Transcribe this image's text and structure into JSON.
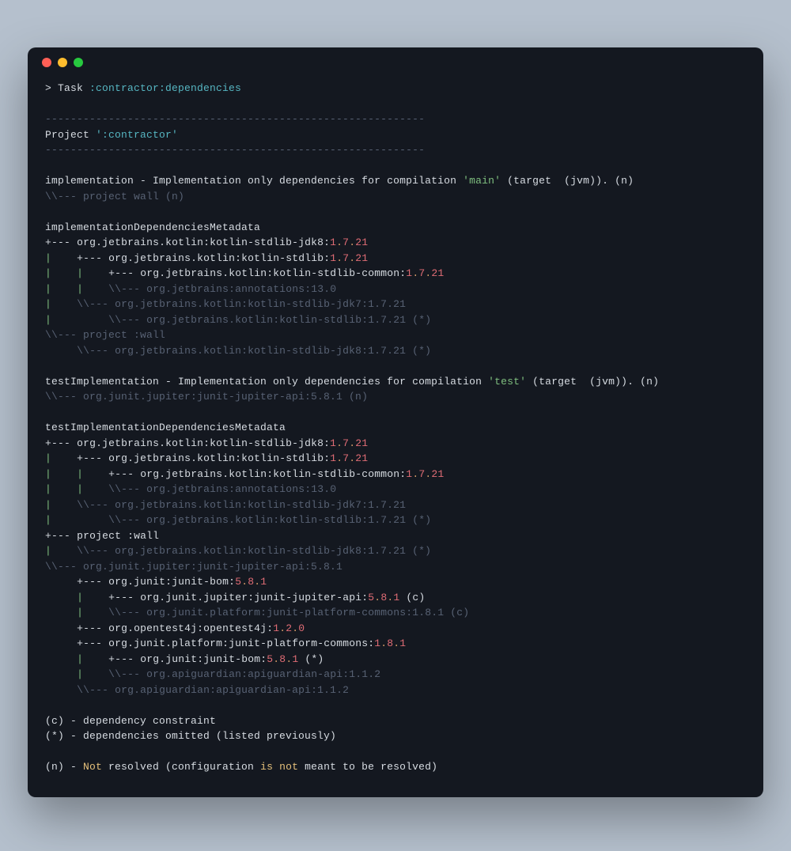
{
  "task_line": {
    "prefix": "> Task ",
    "path": ":contractor:dependencies"
  },
  "dash_line": "------------------------------------------------------------",
  "project_line": {
    "label": "Project ",
    "name": "':contractor'"
  },
  "impl_header": {
    "pre": "implementation - Implementation only dependencies for compilation ",
    "compilation": "'main'",
    "post": " (target  (jvm)). (n)"
  },
  "impl_n_line": "\\\\--- project wall (n)",
  "impl_meta_header": "implementationDependenciesMetadata",
  "tree1": [
    {
      "p": "+--- ",
      "a": "org.jetbrains.kotlin:kotlin-stdlib-jdk8:",
      "v": [
        "1",
        ".",
        "7",
        ".",
        "21"
      ],
      "g": ""
    },
    {
      "p": "|    +--- ",
      "a": "org.jetbrains.kotlin:kotlin-stdlib:",
      "v": [
        "1",
        ".",
        "7",
        ".",
        "21"
      ],
      "g": ""
    },
    {
      "p": "|    |    +--- ",
      "a": "org.jetbrains.kotlin:kotlin-stdlib-common:",
      "v": [
        "1",
        ".",
        "7",
        ".",
        "21"
      ],
      "g": ""
    },
    {
      "p": "|    |    ",
      "a": "",
      "v": [],
      "g": "\\\\--- org.jetbrains:annotations:13.0"
    },
    {
      "p": "|    ",
      "a": "",
      "v": [],
      "g": "\\\\--- org.jetbrains.kotlin:kotlin-stdlib-jdk7:1.7.21"
    },
    {
      "p": "|         ",
      "a": "",
      "v": [],
      "g": "\\\\--- org.jetbrains.kotlin:kotlin-stdlib:1.7.21 (*)"
    },
    {
      "p": "",
      "a": "",
      "v": [],
      "g": "\\\\--- project :wall"
    },
    {
      "p": "     ",
      "a": "",
      "v": [],
      "g": "\\\\--- org.jetbrains.kotlin:kotlin-stdlib-jdk8:1.7.21 (*)"
    }
  ],
  "test_impl_header": {
    "pre": "testImplementation - Implementation only dependencies for compilation ",
    "compilation": "'test'",
    "post": " (target  (jvm)). (n)"
  },
  "test_impl_n_line": "\\\\--- org.junit.jupiter:junit-jupiter-api:5.8.1 (n)",
  "test_meta_header": "testImplementationDependenciesMetadata",
  "tree2": [
    {
      "p": "+--- ",
      "a": "org.jetbrains.kotlin:kotlin-stdlib-jdk8:",
      "v": [
        "1",
        ".",
        "7",
        ".",
        "21"
      ],
      "g": ""
    },
    {
      "p": "|    +--- ",
      "a": "org.jetbrains.kotlin:kotlin-stdlib:",
      "v": [
        "1",
        ".",
        "7",
        ".",
        "21"
      ],
      "g": ""
    },
    {
      "p": "|    |    +--- ",
      "a": "org.jetbrains.kotlin:kotlin-stdlib-common:",
      "v": [
        "1",
        ".",
        "7",
        ".",
        "21"
      ],
      "g": ""
    },
    {
      "p": "|    |    ",
      "a": "",
      "v": [],
      "g": "\\\\--- org.jetbrains:annotations:13.0"
    },
    {
      "p": "|    ",
      "a": "",
      "v": [],
      "g": "\\\\--- org.jetbrains.kotlin:kotlin-stdlib-jdk7:1.7.21"
    },
    {
      "p": "|         ",
      "a": "",
      "v": [],
      "g": "\\\\--- org.jetbrains.kotlin:kotlin-stdlib:1.7.21 (*)"
    },
    {
      "p": "+--- ",
      "a": "project :wall",
      "v": [],
      "g": ""
    },
    {
      "p": "|    ",
      "a": "",
      "v": [],
      "g": "\\\\--- org.jetbrains.kotlin:kotlin-stdlib-jdk8:1.7.21 (*)"
    },
    {
      "p": "",
      "a": "",
      "v": [],
      "g": "\\\\--- org.junit.jupiter:junit-jupiter-api:5.8.1"
    },
    {
      "p": "     +--- ",
      "a": "org.junit:junit-bom:",
      "v": [
        "5",
        ".",
        "8",
        ".",
        "1"
      ],
      "g": ""
    },
    {
      "p": "     |    +--- ",
      "a": "org.junit.jupiter:junit-jupiter-api:",
      "v": [
        "5",
        ".",
        "8",
        ".",
        "1"
      ],
      "g": "",
      "t": " (c)"
    },
    {
      "p": "     |    ",
      "a": "",
      "v": [],
      "g": "\\\\--- org.junit.platform:junit-platform-commons:1.8.1 (c)"
    },
    {
      "p": "     +--- ",
      "a": "org.opentest4j:opentest4j:",
      "v": [
        "1",
        ".",
        "2",
        ".",
        "0"
      ],
      "g": ""
    },
    {
      "p": "     +--- ",
      "a": "org.junit.platform:junit-platform-commons:",
      "v": [
        "1",
        ".",
        "8",
        ".",
        "1"
      ],
      "g": ""
    },
    {
      "p": "     |    +--- ",
      "a": "org.junit:junit-bom:",
      "v": [
        "5",
        ".",
        "8",
        ".",
        "1"
      ],
      "g": "",
      "t": " (*)"
    },
    {
      "p": "     |    ",
      "a": "",
      "v": [],
      "g": "\\\\--- org.apiguardian:apiguardian-api:1.1.2"
    },
    {
      "p": "     ",
      "a": "",
      "v": [],
      "g": "\\\\--- org.apiguardian:apiguardian-api:1.1.2"
    }
  ],
  "legend": {
    "c": "(c) - dependency constraint",
    "star": "(*) - dependencies omitted (listed previously)",
    "n_pre": "(n) - ",
    "n_not": "Not",
    "n_mid": " resolved (configuration ",
    "n_isnot": "is not",
    "n_post": " meant to be resolved)"
  }
}
